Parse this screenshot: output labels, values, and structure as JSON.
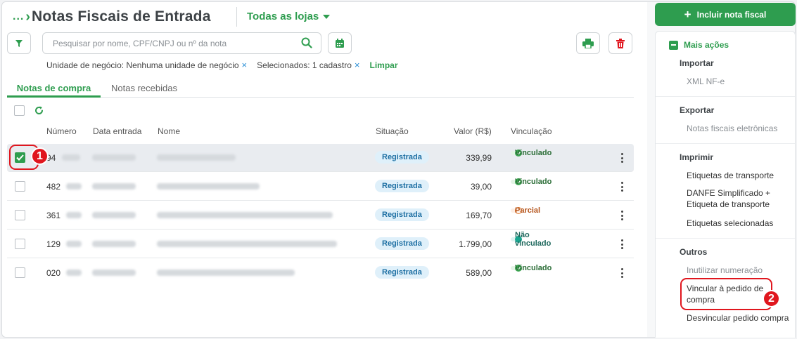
{
  "header": {
    "breadcrumb_dots": "...",
    "title": "Notas Fiscais de Entrada",
    "store_selector": "Todas as lojas"
  },
  "search": {
    "placeholder": "Pesquisar por nome, CPF/CNPJ ou nº da nota",
    "value": ""
  },
  "active_filters": {
    "business_unit": "Unidade de negócio: Nenhuma unidade de negócio",
    "selected": "Selecionados: 1 cadastro",
    "remove_icon": "×",
    "clear_label": "Limpar"
  },
  "tabs": [
    {
      "label": "Notas de compra",
      "active": true
    },
    {
      "label": "Notas recebidas",
      "active": false
    }
  ],
  "table": {
    "columns": [
      "Número",
      "Data entrada",
      "Nome",
      "Situação",
      "Valor (R$)",
      "Vinculação"
    ],
    "rows": [
      {
        "numero": "94",
        "situacao": "Registrada",
        "valor": "339,99",
        "vinculacao": "Vinculado",
        "status": "ok",
        "checked": true
      },
      {
        "numero": "482",
        "situacao": "Registrada",
        "valor": "39,00",
        "vinculacao": "Vinculado",
        "status": "ok",
        "checked": false
      },
      {
        "numero": "361",
        "situacao": "Registrada",
        "valor": "169,70",
        "vinculacao": "Parcial",
        "status": "part",
        "checked": false
      },
      {
        "numero": "129",
        "situacao": "Registrada",
        "valor": "1.799,00",
        "vinculacao": "Não vinculado",
        "status": "nao",
        "checked": false
      },
      {
        "numero": "020",
        "situacao": "Registrada",
        "valor": "589,00",
        "vinculacao": "Vinculado",
        "status": "ok",
        "checked": false
      }
    ]
  },
  "annotations": {
    "marker1": "1",
    "marker2": "2",
    "color": "#e0161e"
  },
  "sidebar": {
    "add_button": "Incluir nota fiscal",
    "more_actions": "Mais ações",
    "sections": {
      "importar": {
        "title": "Importar",
        "items": [
          "XML NF-e"
        ]
      },
      "exportar": {
        "title": "Exportar",
        "items": [
          "Notas fiscais eletrônicas"
        ]
      },
      "imprimir": {
        "title": "Imprimir",
        "items": [
          "Etiquetas de transporte",
          "DANFE Simplificado + Etiqueta de transporte",
          "Etiquetas selecionadas"
        ]
      },
      "outros": {
        "title": "Outros",
        "items": [
          "Inutilizar numeração",
          "Vincular à pedido de compra",
          "Desvincular pedido compra"
        ]
      }
    }
  },
  "colors": {
    "accent": "#2e9d4f",
    "danger": "#e0161e",
    "info": "#1d6fa3"
  }
}
